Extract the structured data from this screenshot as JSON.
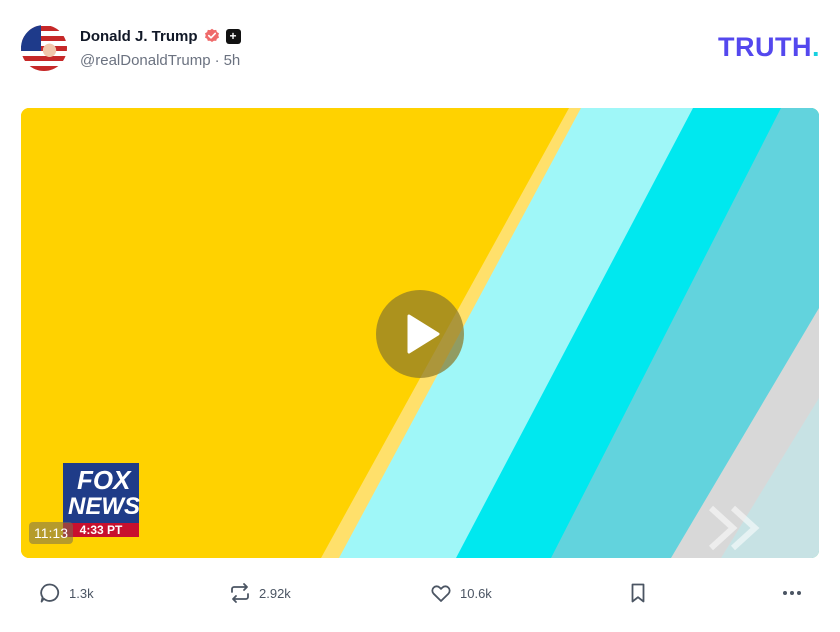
{
  "post": {
    "author": {
      "display_name": "Donald J. Trump",
      "handle": "@realDonaldTrump",
      "time_ago": "5h",
      "separator": "·"
    },
    "brand": {
      "logo_text": "TRUTH",
      "logo_dot": "."
    },
    "video": {
      "duration": "11:13",
      "watermark": {
        "line1": "FOX",
        "line2": "NEWS",
        "time": "4:33 PT"
      }
    },
    "actions": {
      "replies": "1.3k",
      "retruths": "2.92k",
      "likes": "10.6k"
    }
  },
  "colors": {
    "brand_purple": "#5448ee",
    "brand_teal": "#17d1e0",
    "verified": "#ef6a6a",
    "video_yellow": "#ffd200",
    "video_cyan": "#00e5ee"
  },
  "icons": [
    "verified-icon",
    "plus-badge-icon",
    "play-icon",
    "reply-icon",
    "retruth-icon",
    "like-icon",
    "bookmark-icon",
    "more-icon"
  ]
}
